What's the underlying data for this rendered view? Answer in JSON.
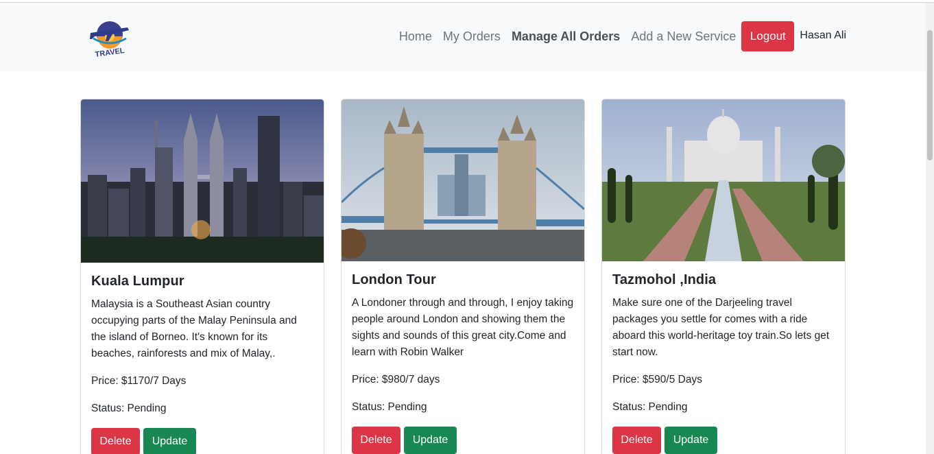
{
  "brand": {
    "logo_text": "TRAVEL"
  },
  "nav": {
    "items": [
      {
        "label": "Home"
      },
      {
        "label": "My Orders"
      },
      {
        "label": "Manage All Orders"
      },
      {
        "label": "Add a New Service"
      }
    ],
    "logout_label": "Logout",
    "user_name": "Hasan Ali"
  },
  "colors": {
    "danger": "#dc3545",
    "success": "#198754",
    "navbar_bg": "#f8f9fa"
  },
  "orders": [
    {
      "title": "Kuala Lumpur",
      "description": "Malaysia is a Southeast Asian country occupying parts of the Malay Peninsula and the island of Borneo. It's known for its beaches, rainforests and mix of Malay,.",
      "price": "Price: $1170/7 Days",
      "status": "Status: Pending",
      "delete_label": "Delete",
      "update_label": "Update"
    },
    {
      "title": "London Tour",
      "description": "A Londoner through and through, I enjoy taking people around London and showing them the sights and sounds of this great city.Come and learn with Robin Walker",
      "price": "Price: $980/7 days",
      "status": "Status: Pending",
      "delete_label": "Delete",
      "update_label": "Update"
    },
    {
      "title": "Tazmohol ,India",
      "description": "Make sure one of the Darjeeling travel packages you settle for comes with a ride aboard this world-heritage toy train.So lets get start now.",
      "price": "Price: $590/5 Days",
      "status": "Status: Pending",
      "delete_label": "Delete",
      "update_label": "Update"
    }
  ]
}
